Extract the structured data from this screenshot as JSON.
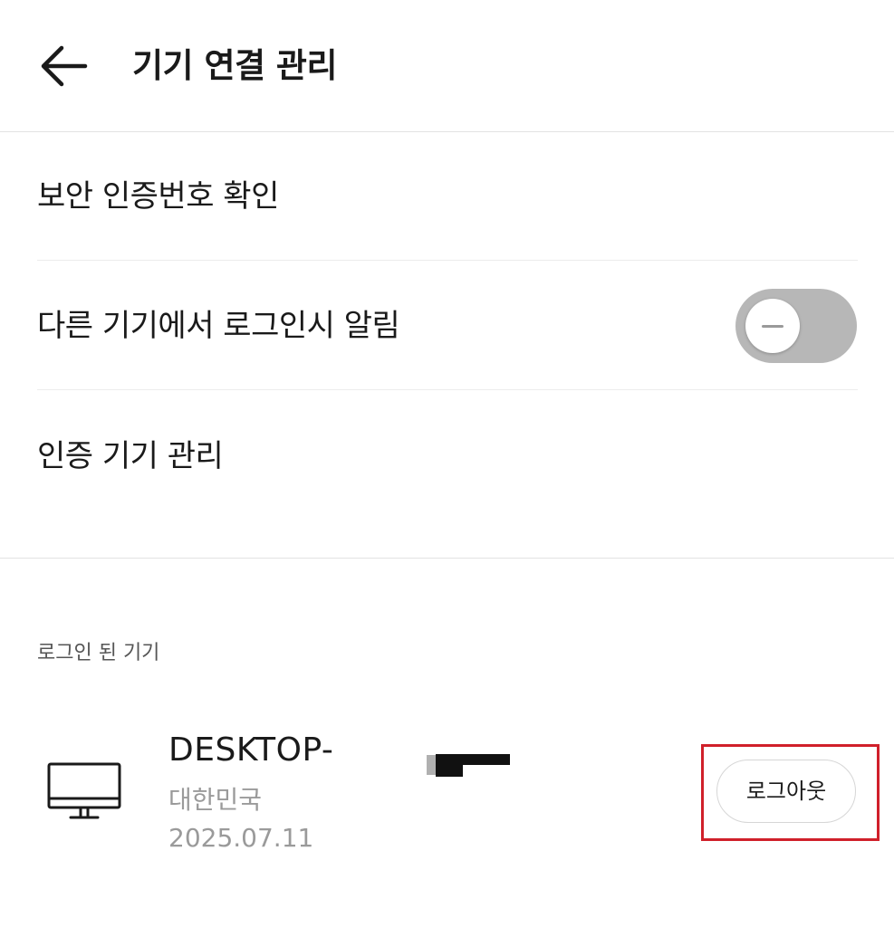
{
  "header": {
    "title": "기기 연결 관리"
  },
  "settings": {
    "rows": [
      {
        "label": "보안 인증번호 확인"
      },
      {
        "label": "다른 기기에서 로그인시 알림"
      },
      {
        "label": "인증 기기 관리"
      }
    ],
    "login_alert_toggle_on": false
  },
  "logged_in_devices": {
    "section_label": "로그인 된 기기",
    "devices": [
      {
        "name": "DESKTOP-",
        "location": "대한민국",
        "date": "2025.07.11",
        "logout_label": "로그아웃"
      }
    ]
  },
  "colors": {
    "toggle_off": "#b7b7b7",
    "highlight": "#d0202a",
    "meta_text": "#9a9a9a"
  }
}
